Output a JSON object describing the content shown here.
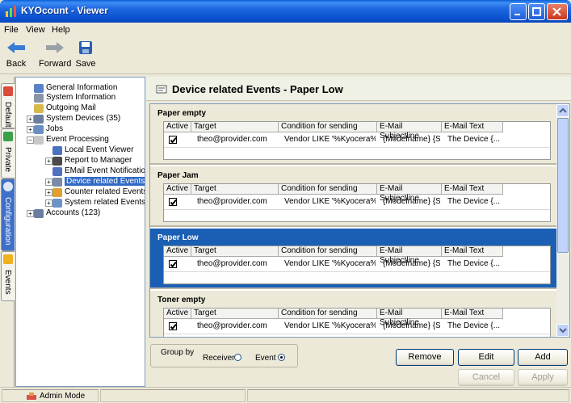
{
  "window": {
    "title": "KYOcount - Viewer"
  },
  "menu": [
    "File",
    "View",
    "Help"
  ],
  "toolbar": {
    "back": "Back",
    "forward": "Forward",
    "save": "Save"
  },
  "side_tabs": [
    "Default",
    "Private",
    "Configuration",
    "Events"
  ],
  "tree": [
    {
      "label": "General Information"
    },
    {
      "label": "System Information"
    },
    {
      "label": "Outgoing Mail"
    },
    {
      "label": "System Devices (35)"
    },
    {
      "label": "Jobs"
    },
    {
      "label": "Event Processing"
    },
    {
      "label": "Local Event Viewer"
    },
    {
      "label": "Report to Manager"
    },
    {
      "label": "EMail Event Notification"
    },
    {
      "label": "Device related Events"
    },
    {
      "label": "Counter related Events"
    },
    {
      "label": "System related Events"
    },
    {
      "label": "Accounts (123)"
    }
  ],
  "panel": {
    "title": "Device related Events - Paper Low"
  },
  "grid_headers": [
    "Active",
    "Target",
    "Condition for sending",
    "E-Mail Subjectline",
    "E-Mail Text"
  ],
  "sections": [
    {
      "title": "Paper empty",
      "row": {
        "target": "theo@provider.com",
        "condition": "Vendor LIKE '%Kyocera%'",
        "subject": "{Modelname} {S...",
        "text": "The Device {..."
      }
    },
    {
      "title": "Paper Jam",
      "row": {
        "target": "theo@provider.com",
        "condition": "Vendor LIKE '%Kyocera%'",
        "subject": "{Modelname} {S...",
        "text": "The Device {..."
      }
    },
    {
      "title": "Paper Low",
      "row": {
        "target": "theo@provider.com",
        "condition": "Vendor LIKE '%Kyocera%'",
        "subject": "{Modelname} {S...",
        "text": "The Device {..."
      }
    },
    {
      "title": "Toner empty",
      "row": {
        "target": "theo@provider.com",
        "condition": "Vendor LIKE '%Kyocera%'",
        "subject": "{Modelname} {S...",
        "text": "The Device {..."
      }
    }
  ],
  "group_by": {
    "label": "Group by",
    "receiver": "Receiver",
    "event": "Event",
    "selected": "Event"
  },
  "buttons": {
    "remove": "Remove",
    "edit": "Edit",
    "add": "Add",
    "cancel": "Cancel",
    "apply": "Apply"
  },
  "status": {
    "mode": "Admin Mode"
  },
  "colors": {
    "titlebar": "#1c66e0",
    "selection": "#1a5fb4"
  }
}
